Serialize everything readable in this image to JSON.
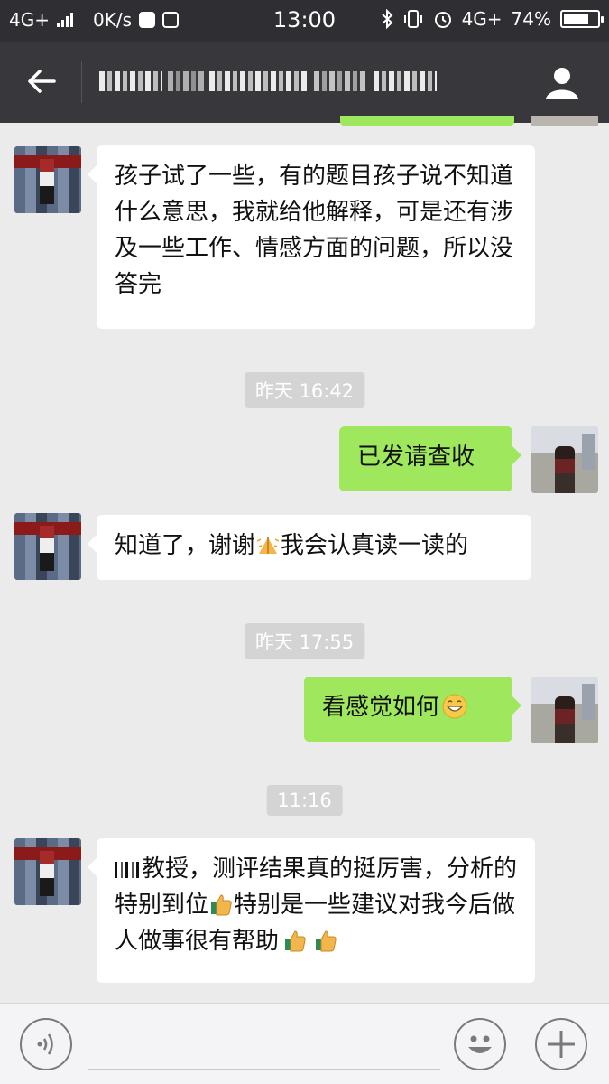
{
  "status_bar": {
    "network": "4G+",
    "speed": "0K/s",
    "time": "13:00",
    "network_right": "4G+",
    "battery": "74%",
    "battery_level": 0.74
  },
  "header": {
    "title": "",
    "back_icon": "back-arrow-icon",
    "profile_icon": "person-icon"
  },
  "messages": [
    {
      "side": "left",
      "text": "孩子试了一些，有的题目孩子说不知道什么意思，我就给他解释，可是还有涉及一些工作、情感方面的问题，所以没答完"
    },
    {
      "type": "time",
      "text": "昨天 16:42"
    },
    {
      "side": "right",
      "text": "已发请查收"
    },
    {
      "side": "left",
      "text_a": "知道了，谢谢",
      "emoji": "folded-hands",
      "text_b": "我会认真读一读的"
    },
    {
      "type": "time",
      "text": "昨天 17:55"
    },
    {
      "side": "right",
      "text": "看感觉如何",
      "emoji": "grinning-face"
    },
    {
      "type": "time",
      "text": "11:16"
    },
    {
      "side": "left",
      "text_a": "教授，测评结果真的挺厉害，分析的特别到位",
      "text_b": "特别是一些建议对我今后做人做事很有帮助",
      "emoji": "thumbs-up"
    }
  ],
  "input_bar": {
    "voice_icon": "voice-icon",
    "emoji_icon": "smiley-icon",
    "plus_icon": "plus-icon",
    "input_value": ""
  }
}
